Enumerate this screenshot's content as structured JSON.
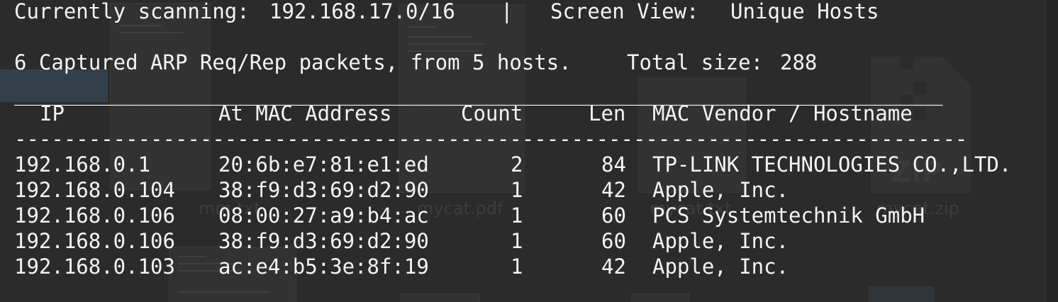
{
  "status": {
    "scanning_label": "Currently scanning:",
    "range": "192.168.17.0/16",
    "separator": "|",
    "view_label": "Screen View:",
    "view_value": "Unique Hosts"
  },
  "summary": {
    "text": "6 Captured ARP Req/Rep packets, from 5 hosts.",
    "size_label": "Total size:",
    "size_value": "288"
  },
  "table": {
    "rule": "___________________________________________________________________________",
    "dashes": "-----------------------------------------------------------------------------",
    "headers": {
      "ip": "IP",
      "mac": "At MAC Address",
      "count": "Count",
      "len": "Len",
      "vendor": "MAC Vendor / Hostname"
    },
    "rows": [
      {
        "ip": "192.168.0.1",
        "mac": "20:6b:e7:81:e1:ed",
        "count": "2",
        "len": "84",
        "vendor": "TP-LINK TECHNOLOGIES CO.,LTD."
      },
      {
        "ip": "192.168.0.104",
        "mac": "38:f9:d3:69:d2:90",
        "count": "1",
        "len": "42",
        "vendor": "Apple, Inc."
      },
      {
        "ip": "192.168.0.106",
        "mac": "08:00:27:a9:b4:ac",
        "count": "1",
        "len": "60",
        "vendor": "PCS Systemtechnik GmbH"
      },
      {
        "ip": "192.168.0.106",
        "mac": "38:f9:d3:69:d2:90",
        "count": "1",
        "len": "60",
        "vendor": "Apple, Inc."
      },
      {
        "ip": "192.168.0.103",
        "mac": "ac:e4:b5:3e:8f:19",
        "count": "1",
        "len": "42",
        "vendor": "Apple, Inc."
      }
    ]
  },
  "desktop": {
    "files": [
      {
        "name": "mm.txt"
      },
      {
        "name": "mycat.pdf"
      },
      {
        "name": "mycat.txt"
      },
      {
        "name": "mycat.zip"
      }
    ],
    "zip_badge": "ZIP"
  },
  "colors": {
    "terminal_bg": "#2b2b2b",
    "terminal_fg": "#f4f4f4"
  }
}
